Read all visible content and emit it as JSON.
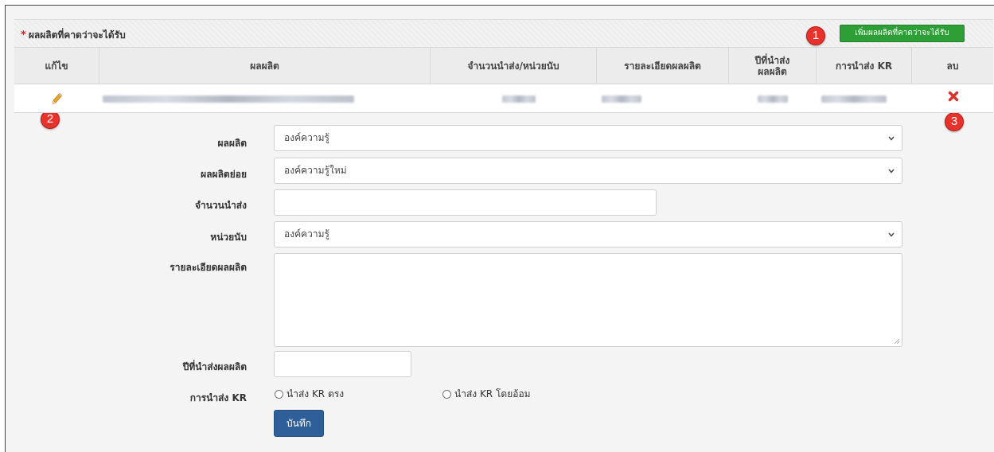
{
  "panel": {
    "required_star": "*",
    "title": "ผลผลิตที่คาดว่าจะได้รับ",
    "add_button_label": "เพิ่มผลผลิตที่คาดว่าจะได้รับ"
  },
  "callouts": [
    "1",
    "2",
    "3"
  ],
  "table": {
    "headers": {
      "edit": "แก้ไข",
      "product": "ผลผลิต",
      "quantity_unit": "จำนวนนำส่ง/หน่วยนับ",
      "detail": "รายละเอียดผลผลิต",
      "year_line1": "ปีที่นำส่ง",
      "year_line2": "ผลผลิต",
      "kr": "การนำส่ง KR",
      "delete": "ลบ"
    },
    "row_icons": {
      "edit": "pencil-icon",
      "delete": "x-icon"
    }
  },
  "form": {
    "product_label": "ผลผลิต",
    "product_value": "องค์ความรู้",
    "subproduct_label": "ผลผลิตย่อย",
    "subproduct_value": "องค์ความรู้ใหม่",
    "quantity_label": "จำนวนนำส่ง",
    "quantity_value": "",
    "unit_label": "หน่วยนับ",
    "unit_value": "องค์ความรู้",
    "detail_label": "รายละเอียดผลผลิต",
    "detail_value": "",
    "year_label": "ปีที่นำส่งผลผลิต",
    "year_value": "",
    "kr_label": "การนำส่ง KR",
    "kr_options": [
      "นำส่ง KR ตรง",
      "นำส่ง KR โดยอ้อม"
    ],
    "save_label": "บันทึก"
  },
  "colors": {
    "add_button": "#2e9e36",
    "save_button": "#2f5f99",
    "callout": "#e8322c",
    "delete_icon": "#d9342b",
    "required_star": "#e02020"
  }
}
